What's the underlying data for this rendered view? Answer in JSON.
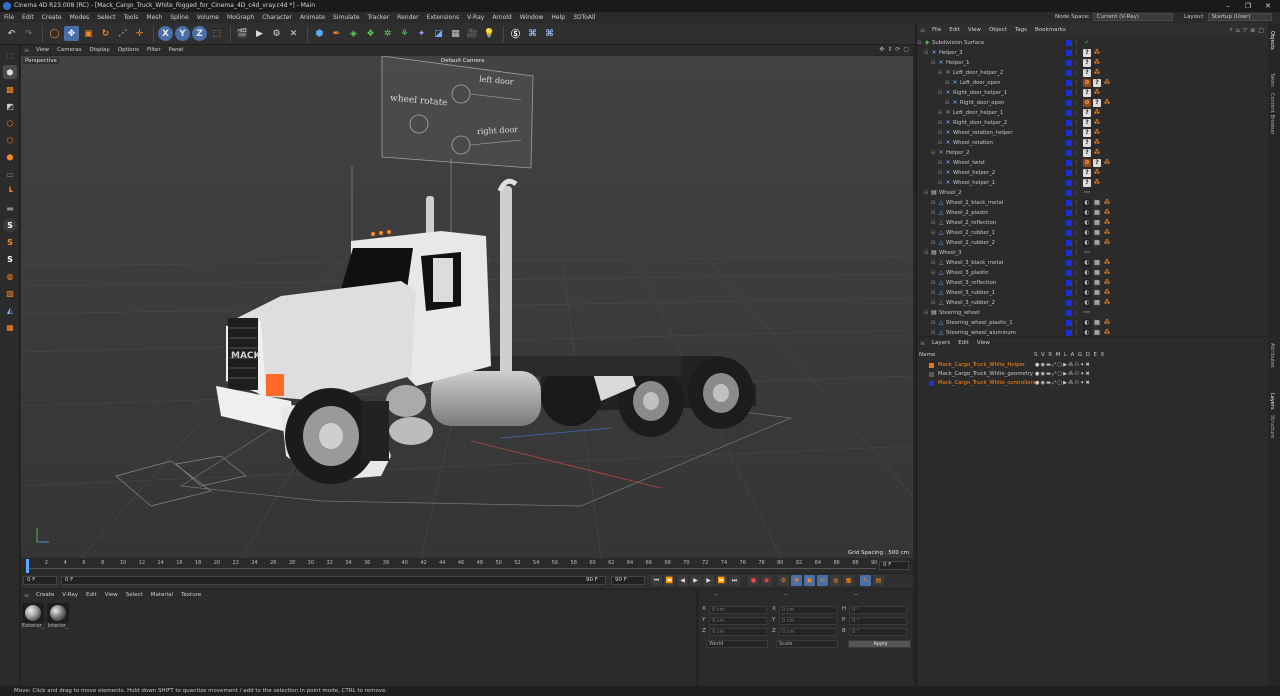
{
  "titlebar": {
    "title": "Cinema 4D R23.008 (RC) - [Mack_Cargo_Truck_White_Rigged_for_Cinema_4D_c4d_vray.c4d *] - Main",
    "minimize": "–",
    "maximize": "❐",
    "close": "✕"
  },
  "menubar": {
    "items": [
      "File",
      "Edit",
      "Create",
      "Modes",
      "Select",
      "Tools",
      "Mesh",
      "Spline",
      "Volume",
      "MoGraph",
      "Character",
      "Animate",
      "Simulate",
      "Tracker",
      "Render",
      "Extensions",
      "V-Ray",
      "Arnold",
      "Window",
      "Help",
      "3DToAll"
    ],
    "node_space_label": "Node Space:",
    "node_space_value": "Current (V-Ray)",
    "layout_label": "Layout:",
    "layout_value": "Startup (User)"
  },
  "toolbar": {
    "axis_x": "X",
    "axis_y": "Y",
    "axis_z": "Z"
  },
  "viewport": {
    "menu": [
      "View",
      "Cameras",
      "Display",
      "Options",
      "Filter",
      "Panel"
    ],
    "label": "Perspective",
    "camera": "Default Camera",
    "grid_spacing": "Grid Spacing : 500 cm",
    "sign_wheel_rotate": "wheel rotate",
    "sign_left_door": "left door",
    "sign_right_door": "right door",
    "truck_brand": "MACK"
  },
  "timeline": {
    "ticks": [
      "0",
      "2",
      "4",
      "6",
      "8",
      "10",
      "12",
      "14",
      "16",
      "18",
      "20",
      "22",
      "24",
      "26",
      "28",
      "30",
      "32",
      "34",
      "36",
      "38",
      "40",
      "42",
      "44",
      "46",
      "48",
      "50",
      "52",
      "54",
      "56",
      "58",
      "60",
      "62",
      "64",
      "66",
      "68",
      "70",
      "72",
      "74",
      "76",
      "78",
      "80",
      "82",
      "84",
      "86",
      "88",
      "90"
    ],
    "current_frame_right": "0 F"
  },
  "transport": {
    "start": "0 F",
    "current": "0 F",
    "end": "90 F",
    "end2": "90 F"
  },
  "material_manager": {
    "menu": [
      "Create",
      "V-Ray",
      "Edit",
      "View",
      "Select",
      "Material",
      "Texture"
    ],
    "materials": [
      {
        "name": "Exterior_",
        "color": "#9a9a9a"
      },
      {
        "name": "Interior_",
        "color": "#7d7d7d"
      }
    ]
  },
  "coordinates": {
    "header_left": "--",
    "header_mid": "--",
    "header_right": "--",
    "labels": [
      "X",
      "Y",
      "Z",
      "X",
      "Y",
      "Z",
      "H",
      "P",
      "B"
    ],
    "values": [
      "0 cm",
      "0 cm",
      "0 cm",
      "0 cm",
      "0 cm",
      "0 cm",
      "0 °",
      "0 °",
      "0 °"
    ],
    "mode": "World",
    "scale_mode": "Scale",
    "apply": "Apply"
  },
  "statusbar": {
    "text": "Move: Click and drag to move elements. Hold down SHIFT to quantize movement / add to the selection in point mode, CTRL to remove."
  },
  "objects_manager": {
    "menu": [
      "File",
      "Edit",
      "View",
      "Object",
      "Tags",
      "Bookmarks"
    ],
    "objects": [
      {
        "name": "Subdivision Surface",
        "depth": 0,
        "icon": "subdivision-icon"
      },
      {
        "name": "Helper_3",
        "depth": 1,
        "icon": "null-icon"
      },
      {
        "name": "Helper_1",
        "depth": 2,
        "icon": "null-icon"
      },
      {
        "name": "Left_door_helper_2",
        "depth": 3,
        "icon": "null-icon"
      },
      {
        "name": "Left_door_open",
        "depth": 4,
        "icon": "null-icon"
      },
      {
        "name": "Right_door_helper_1",
        "depth": 3,
        "icon": "null-icon"
      },
      {
        "name": "Right_door_open",
        "depth": 4,
        "icon": "null-icon"
      },
      {
        "name": "Left_door_helper_1",
        "depth": 3,
        "icon": "null-icon"
      },
      {
        "name": "Right_door_helper_2",
        "depth": 3,
        "icon": "null-icon"
      },
      {
        "name": "Wheel_rotation_helper",
        "depth": 3,
        "icon": "null-icon"
      },
      {
        "name": "Wheel_rotation",
        "depth": 3,
        "icon": "null-icon"
      },
      {
        "name": "Helper_2",
        "depth": 2,
        "icon": "null-icon"
      },
      {
        "name": "Wheel_twist",
        "depth": 3,
        "icon": "null-icon"
      },
      {
        "name": "Wheel_helper_2",
        "depth": 3,
        "icon": "null-icon"
      },
      {
        "name": "Wheel_helper_1",
        "depth": 3,
        "icon": "null-icon"
      },
      {
        "name": "Wheel_2",
        "depth": 1,
        "icon": "group-icon"
      },
      {
        "name": "Wheel_2_black_metal",
        "depth": 2,
        "icon": "mesh-icon"
      },
      {
        "name": "Wheel_2_plastic",
        "depth": 2,
        "icon": "mesh-icon"
      },
      {
        "name": "Wheel_2_reflection",
        "depth": 2,
        "icon": "mesh-icon"
      },
      {
        "name": "Wheel_2_rubber_1",
        "depth": 2,
        "icon": "mesh-icon"
      },
      {
        "name": "Wheel_2_rubber_2",
        "depth": 2,
        "icon": "mesh-icon"
      },
      {
        "name": "Wheel_3",
        "depth": 1,
        "icon": "group-icon"
      },
      {
        "name": "Wheel_3_black_metal",
        "depth": 2,
        "icon": "mesh-icon"
      },
      {
        "name": "Wheel_3_plastic",
        "depth": 2,
        "icon": "mesh-icon"
      },
      {
        "name": "Wheel_3_reflection",
        "depth": 2,
        "icon": "mesh-icon"
      },
      {
        "name": "Wheel_3_rubber_1",
        "depth": 2,
        "icon": "mesh-icon"
      },
      {
        "name": "Wheel_3_rubber_2",
        "depth": 2,
        "icon": "mesh-icon"
      },
      {
        "name": "Steering_wheel",
        "depth": 1,
        "icon": "group-icon"
      },
      {
        "name": "Steering_wheel_plastic_1",
        "depth": 2,
        "icon": "mesh-icon"
      },
      {
        "name": "Steering_wheel_aluminum",
        "depth": 2,
        "icon": "mesh-icon"
      }
    ]
  },
  "layers_manager": {
    "menu": [
      "Layers",
      "Edit",
      "View"
    ],
    "col_name": "Name",
    "col_flags": "S V R M L A G D E X",
    "layers": [
      {
        "name": "Mack_Cargo_Truck_White_Helper",
        "color": "#e07a2a"
      },
      {
        "name": "Mack_Cargo_Truck_White_geometry",
        "color": "#5a5a5a"
      },
      {
        "name": "Mack_Cargo_Truck_White_controllers",
        "color": "#2233cc"
      }
    ]
  },
  "right_tabs": [
    "Objects",
    "Takes",
    "Content Browser",
    "Attributes",
    "Layers",
    "Structure"
  ],
  "colors": {
    "accent": "#ff8a1e",
    "selection": "#4a90d9",
    "layer_blue": "#1f2fd6"
  }
}
